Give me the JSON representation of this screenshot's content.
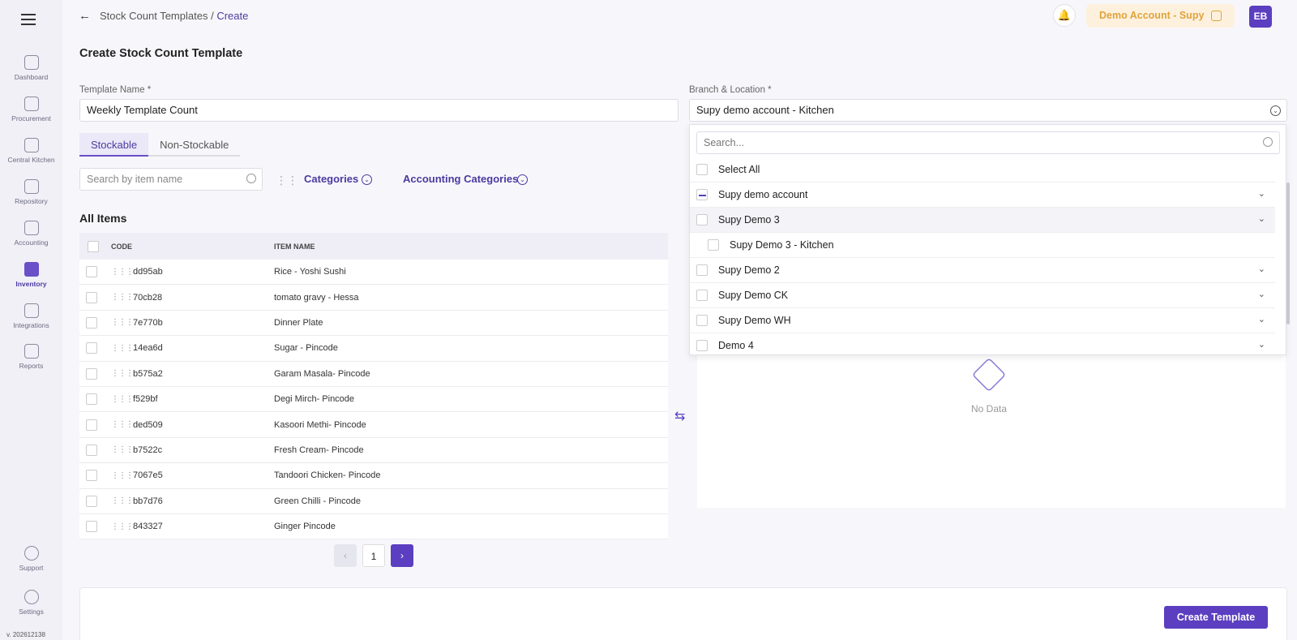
{
  "sidebar": {
    "items": [
      {
        "label": "Dashboard",
        "icon": "dashboard-icon"
      },
      {
        "label": "Procurement",
        "icon": "cart-icon"
      },
      {
        "label": "Central Kitchen",
        "icon": "kitchen-icon"
      },
      {
        "label": "Repository",
        "icon": "repository-icon"
      },
      {
        "label": "Accounting",
        "icon": "accounting-icon"
      },
      {
        "label": "Inventory",
        "icon": "inventory-icon",
        "active": true
      },
      {
        "label": "Integrations",
        "icon": "integrations-icon"
      },
      {
        "label": "Reports",
        "icon": "reports-icon"
      }
    ],
    "bottom": [
      {
        "label": "Support",
        "icon": "support-icon"
      },
      {
        "label": "Settings",
        "icon": "gear-icon"
      }
    ],
    "version": "v. 202612138"
  },
  "header": {
    "breadcrumb_parent": "Stock Count Templates",
    "breadcrumb_sep": "/",
    "breadcrumb_current": "Create",
    "account_label": "Demo Account - Supy",
    "avatar_initials": "EB"
  },
  "page_title": "Create Stock Count Template",
  "form": {
    "template_name_label": "Template Name *",
    "template_name_value": "Weekly Template Count",
    "branch_label": "Branch & Location *",
    "branch_value": "Supy demo account  - Kitchen"
  },
  "tabs": [
    "Stockable",
    "Non-Stockable"
  ],
  "filters": {
    "search_placeholder": "Search by item name",
    "categories_label": "Categories",
    "accounting_categories_label": "Accounting Categories"
  },
  "section_title": "All Items",
  "table": {
    "columns": [
      "CODE",
      "ITEM NAME"
    ],
    "rows": [
      {
        "code": "dd95ab",
        "name": "Rice - Yoshi Sushi"
      },
      {
        "code": "70cb28",
        "name": "tomato gravy - Hessa"
      },
      {
        "code": "7e770b",
        "name": "Dinner Plate"
      },
      {
        "code": "14ea6d",
        "name": "Sugar - Pincode"
      },
      {
        "code": "b575a2",
        "name": "Garam Masala- Pincode"
      },
      {
        "code": "f529bf",
        "name": "Degi Mirch- Pincode"
      },
      {
        "code": "ded509",
        "name": "Kasoori Methi- Pincode"
      },
      {
        "code": "b7522c",
        "name": "Fresh Cream- Pincode"
      },
      {
        "code": "7067e5",
        "name": "Tandoori Chicken- Pincode"
      },
      {
        "code": "bb7d76",
        "name": "Green Chilli - Pincode"
      },
      {
        "code": "843327",
        "name": "Ginger Pincode"
      }
    ]
  },
  "pagination": {
    "current_page": "1"
  },
  "dropdown": {
    "search_placeholder": "Search...",
    "select_all": "Select All",
    "options": [
      {
        "label": "Supy demo account",
        "level": 0,
        "state": "partial",
        "expandable": true
      },
      {
        "label": "Supy Demo 3",
        "level": 0,
        "state": "unchecked",
        "expandable": true,
        "highlighted": true
      },
      {
        "label": "Supy Demo 3 - Kitchen",
        "level": 1,
        "state": "unchecked",
        "expandable": false
      },
      {
        "label": "Supy Demo 2",
        "level": 0,
        "state": "unchecked",
        "expandable": true
      },
      {
        "label": "Supy Demo CK",
        "level": 0,
        "state": "unchecked",
        "expandable": true
      },
      {
        "label": "Supy Demo WH",
        "level": 0,
        "state": "unchecked",
        "expandable": true
      },
      {
        "label": "Demo 4",
        "level": 0,
        "state": "unchecked",
        "expandable": true
      }
    ]
  },
  "empty_state": "No Data",
  "footer": {
    "create_button": "Create Template"
  },
  "colors": {
    "accent": "#5b3fc0",
    "account_bg": "#fdf1de",
    "account_text": "#e0a33a"
  }
}
